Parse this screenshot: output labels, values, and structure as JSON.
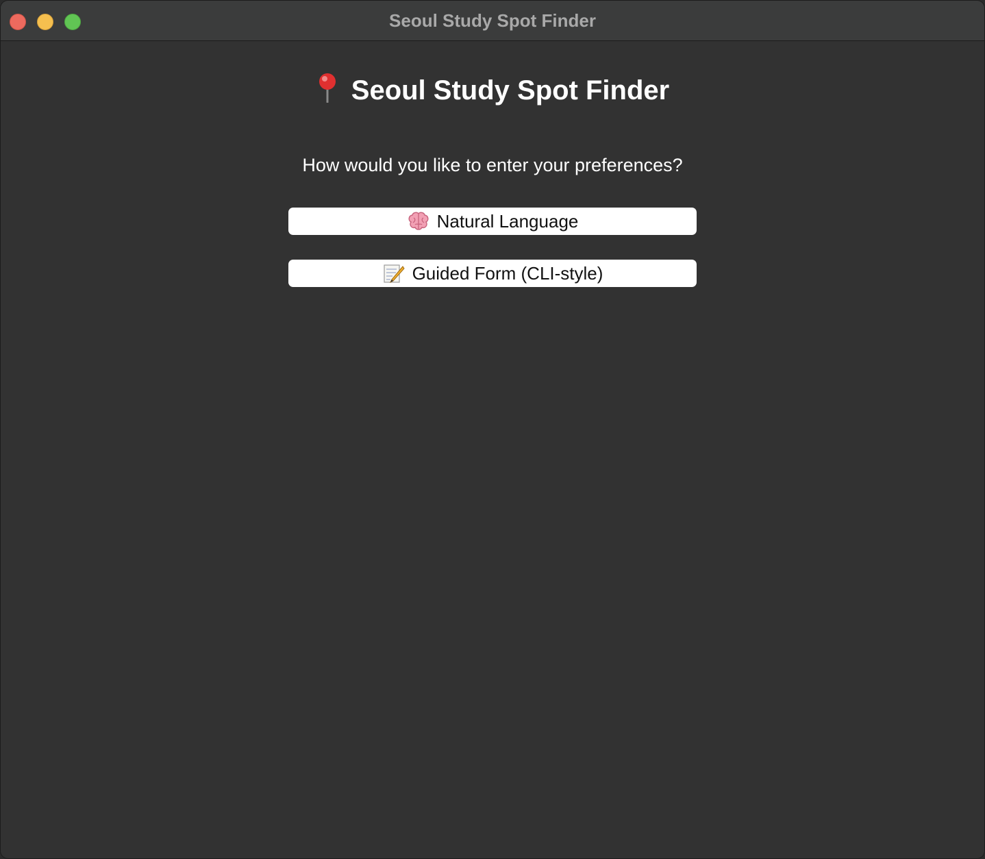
{
  "window": {
    "title": "Seoul Study Spot Finder"
  },
  "main": {
    "heading_icon": "pushpin-icon",
    "heading": "Seoul Study Spot Finder",
    "prompt": "How would you like to enter your preferences?",
    "options": [
      {
        "icon": "brain-icon",
        "label": "Natural Language"
      },
      {
        "icon": "memo-pencil-icon",
        "label": "Guided Form (CLI-style)"
      }
    ]
  },
  "colors": {
    "window_background": "#323232",
    "titlebar_background": "#3b3c3c",
    "close": "#ed6a5e",
    "minimize": "#f5bf4f",
    "maximize": "#61c554",
    "button_background": "#ffffff",
    "heading_text": "#ffffff"
  }
}
